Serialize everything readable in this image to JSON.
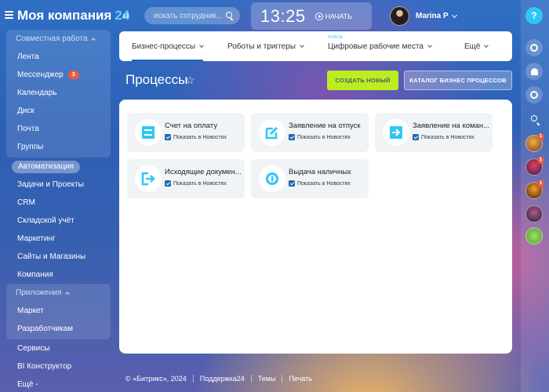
{
  "header": {
    "logo_text": "Моя компания",
    "logo_suffix": "24",
    "swap_symbol": "⇄",
    "search_placeholder": "искать сотрудник...",
    "clock": "13:25",
    "start_label": "НАЧАТЬ",
    "user_name": "Marina P"
  },
  "sidebar": {
    "groups": [
      {
        "title": "Совместная работа",
        "items": [
          {
            "label": "Лента"
          },
          {
            "label": "Мессенджер",
            "count": "3"
          },
          {
            "label": "Календарь"
          },
          {
            "label": "Диск"
          },
          {
            "label": "Почта"
          },
          {
            "label": "Группы"
          }
        ]
      }
    ],
    "items_after": [
      {
        "label": "Автоматизация",
        "active": true
      },
      {
        "label": "Задачи и Проекты"
      },
      {
        "label": "CRM"
      },
      {
        "label": "Складской учёт"
      },
      {
        "label": "Маркетинг"
      },
      {
        "label": "Сайты и Магазины"
      },
      {
        "label": "Компания"
      }
    ],
    "apps_group": {
      "title": "Приложения",
      "items": [
        {
          "label": "Маркет"
        },
        {
          "label": "Разработчикам"
        }
      ]
    },
    "items_bottom": [
      {
        "label": "Сервисы"
      },
      {
        "label": "BI Конструктор"
      },
      {
        "label": "Ещё -"
      }
    ]
  },
  "tabs": [
    {
      "label": "Бизнес-процессы",
      "active": true
    },
    {
      "label": "Роботы и триггеры"
    },
    {
      "label": "Цифровые рабочие места",
      "badge": "НОВОЕ"
    },
    {
      "label": "Ещё"
    }
  ],
  "page": {
    "title": "Процессы",
    "create_button": "СОЗДАТЬ НОВЫЙ",
    "catalog_button": "КАТАЛОГ БИЗНЕС ПРОЦЕССОВ"
  },
  "processes": [
    {
      "name": "Счет на оплату",
      "checkbox_label": "Показать в Новостях",
      "icon": "invoice-icon"
    },
    {
      "name": "Заявление на отпуск",
      "checkbox_label": "Показать в Новостях",
      "icon": "edit-document-icon"
    },
    {
      "name": "Заявление на коман...",
      "checkbox_label": "Показать в Новостях",
      "icon": "business-trip-icon"
    },
    {
      "name": "Исходящие докумен...",
      "checkbox_label": "Показать в Новостях",
      "icon": "outgoing-documents-icon"
    },
    {
      "name": "Выдача наличных",
      "checkbox_label": "Показать в Новостях",
      "icon": "cash-icon"
    }
  ],
  "footer": {
    "copyright": "© «Битрикс», 2024",
    "support": "Поддержка24",
    "themes": "Темы",
    "print": "Печать"
  },
  "colors": {
    "accent_green": "#bbed21",
    "accent_blue": "#2067b0",
    "icon_cyan": "#2fc6f6",
    "badge_red": "#f05a3c"
  }
}
